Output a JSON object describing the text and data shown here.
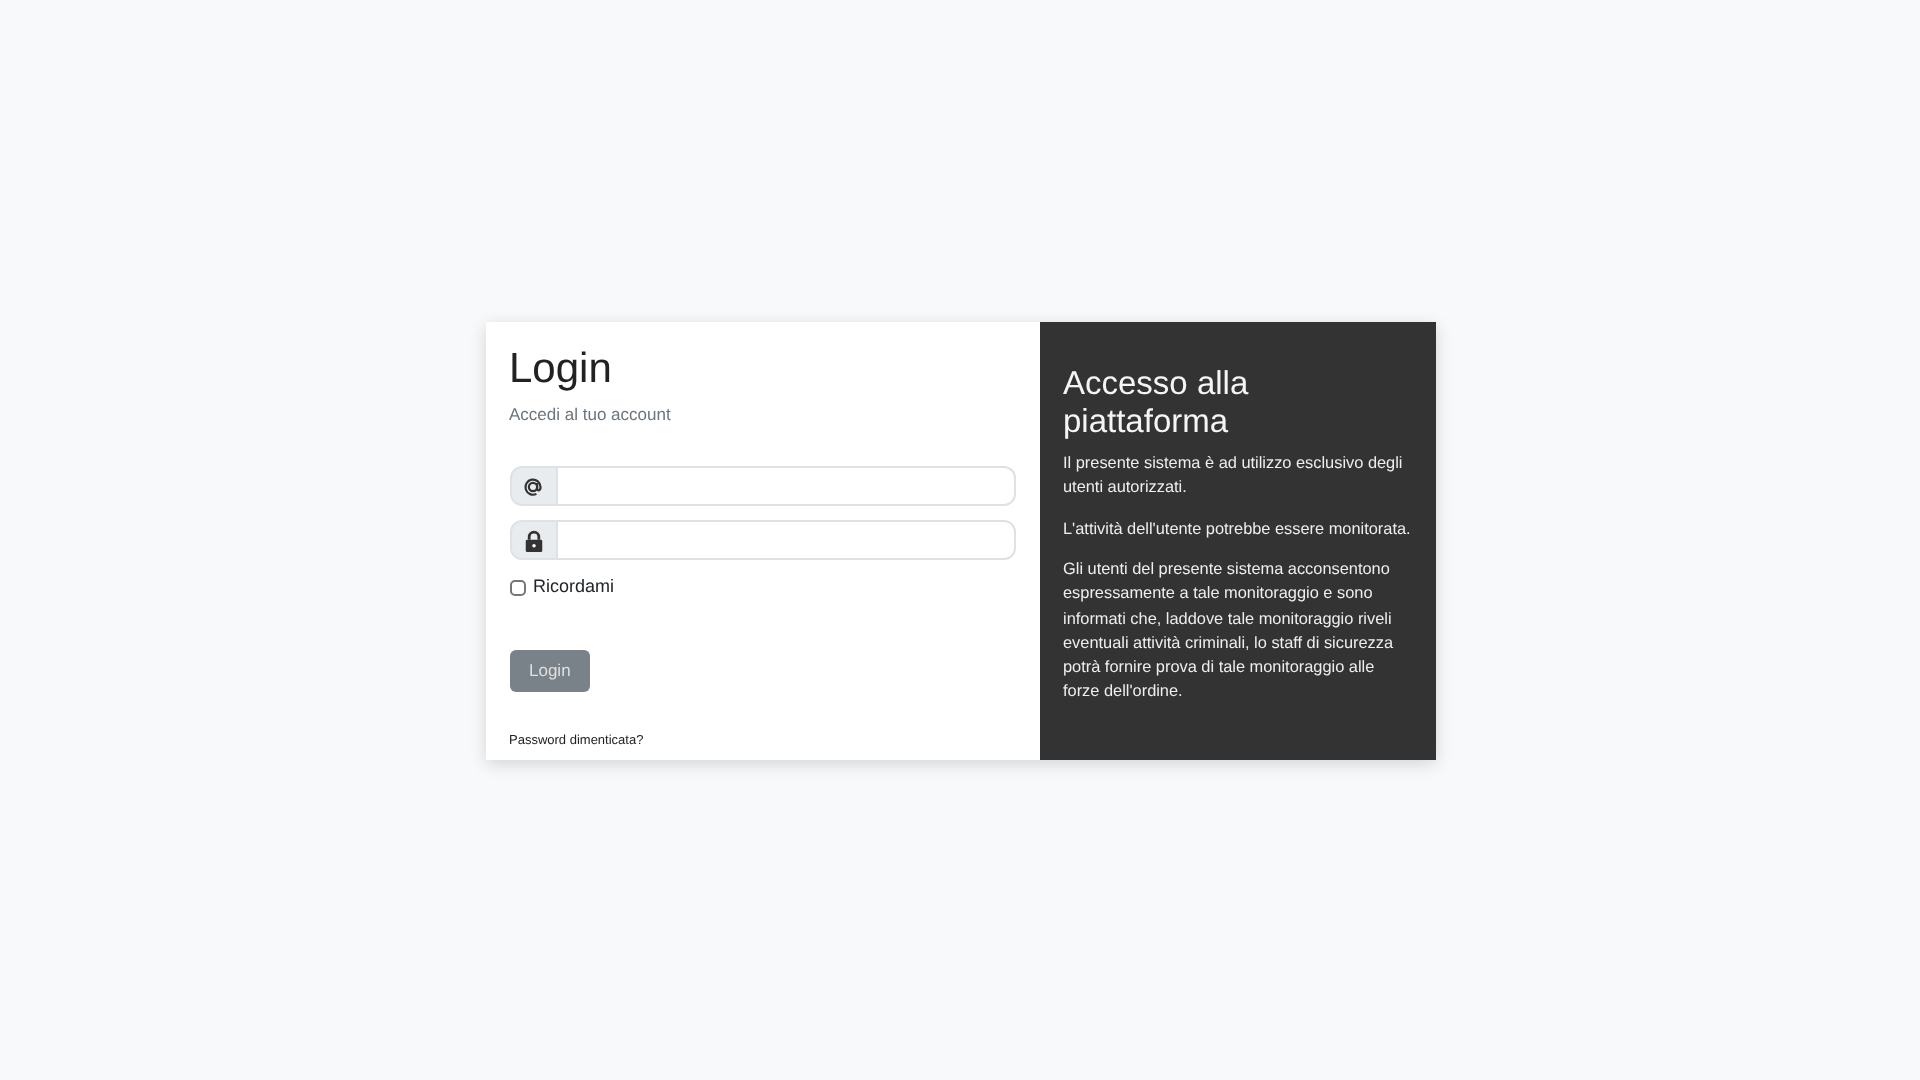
{
  "login": {
    "title": "Login",
    "subtitle": "Accedi al tuo account",
    "fields": [
      {
        "kind": "email"
      },
      {
        "kind": "password"
      }
    ],
    "remember": {
      "label": "Ricordami",
      "checked": false
    },
    "button": {
      "label": "Login",
      "disabled": true
    },
    "forgot_link": "Password dimenticata?"
  },
  "info": {
    "title": "Accesso alla piattaforma",
    "paragraphs": [
      "Il presente sistema è ad utilizzo esclusivo degli utenti autorizzati.",
      "L'attività dell'utente potrebbe essere monitorata.",
      "Gli utenti del presente sistema acconsentono espressamente a tale monitoraggio e sono informati che, laddove tale monitoraggio riveli eventuali attività criminali, lo staff di sicurezza potrà fornire prova di tale monitoraggio alle forze dell'ordine."
    ]
  }
}
